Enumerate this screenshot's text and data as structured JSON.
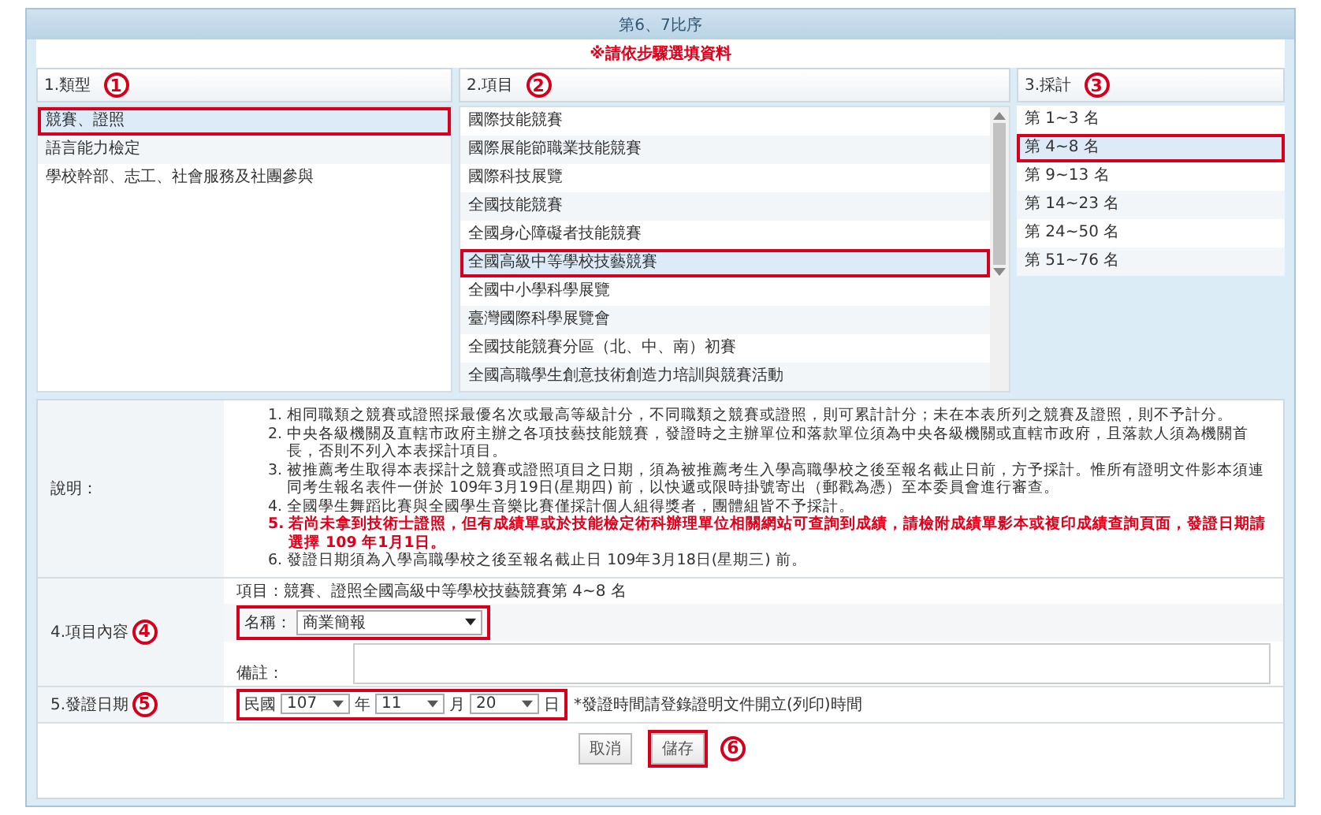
{
  "window": {
    "title": "第6、7比序"
  },
  "notice": "※請依步驟選填資料",
  "columns": [
    {
      "header": "1.類型",
      "step": "1",
      "items": [
        {
          "label": "競賽、證照",
          "selected": true,
          "highlighted": true
        },
        {
          "label": "語言能力檢定",
          "selected": false,
          "highlighted": false
        },
        {
          "label": "學校幹部、志工、社會服務及社團參與",
          "selected": false,
          "highlighted": false
        }
      ]
    },
    {
      "header": "2.項目",
      "step": "2",
      "items": [
        {
          "label": "國際技能競賽",
          "selected": false,
          "highlighted": false
        },
        {
          "label": "國際展能節職業技能競賽",
          "selected": false,
          "highlighted": false
        },
        {
          "label": "國際科技展覽",
          "selected": false,
          "highlighted": false
        },
        {
          "label": "全國技能競賽",
          "selected": false,
          "highlighted": false
        },
        {
          "label": "全國身心障礙者技能競賽",
          "selected": false,
          "highlighted": false
        },
        {
          "label": "全國高級中等學校技藝競賽",
          "selected": true,
          "highlighted": true
        },
        {
          "label": "全國中小學科學展覽",
          "selected": false,
          "highlighted": false
        },
        {
          "label": "臺灣國際科學展覽會",
          "selected": false,
          "highlighted": false
        },
        {
          "label": "全國技能競賽分區（北、中、南）初賽",
          "selected": false,
          "highlighted": false
        },
        {
          "label": "全國高職學生創意技術創造力培訓與競賽活動",
          "selected": false,
          "highlighted": false
        }
      ]
    },
    {
      "header": "3.採計",
      "step": "3",
      "items": [
        {
          "label": "第 1~3 名",
          "selected": false,
          "highlighted": false
        },
        {
          "label": "第 4~8 名",
          "selected": true,
          "highlighted": true
        },
        {
          "label": "第 9~13 名",
          "selected": false,
          "highlighted": false
        },
        {
          "label": "第 14~23 名",
          "selected": false,
          "highlighted": false
        },
        {
          "label": "第 24~50 名",
          "selected": false,
          "highlighted": false
        },
        {
          "label": "第 51~76 名",
          "selected": false,
          "highlighted": false
        }
      ]
    }
  ],
  "notes": {
    "label": "說明：",
    "items": [
      {
        "kind": "normal",
        "number": "1.",
        "text": "相同職類之競賽或證照採最優名次或最高等級計分，不同職類之競賽或證照，則可累計計分；未在本表所列之競賽及證照，則不予計分。"
      },
      {
        "kind": "normal",
        "number": "2.",
        "text": "中央各級機關及直轄市政府主辦之各項技藝技能競賽，發證時之主辦單位和落款單位須為中央各級機關或直轄市政府，且落款人須為機關首長，否則不列入本表採計項目。"
      },
      {
        "kind": "normal",
        "number": "3.",
        "text": "被推薦考生取得本表採計之競賽或證照項目之日期，須為被推薦考生入學高職學校之後至報名截止日前，方予採計。惟所有證明文件影本須連同考生報名表件一併於 109年3月19日(星期四) 前，以快遞或限時掛號寄出（郵戳為憑）至本委員會進行審查。"
      },
      {
        "kind": "normal",
        "number": "4.",
        "text": "全國學生舞蹈比賽與全國學生音樂比賽僅採計個人組得獎者，團體組皆不予採計。"
      },
      {
        "kind": "warning",
        "number": "5.",
        "text": "若尚未拿到技術士證照，但有成績單或於技能檢定術科辦理單位相關網站可查詢到成績，請檢附成績單影本或複印成績查詢頁面，發證日期請選擇 109 年1月1日。"
      },
      {
        "kind": "normal",
        "number": "6.",
        "text": "發證日期須為入學高職學校之後至報名截止日 109年3月18日(星期三) 前。"
      }
    ]
  },
  "item_content": {
    "label": "4.項目內容",
    "step": "4",
    "item_text": "項目：競賽、證照全國高級中等學校技藝競賽第 4~8 名",
    "name_label": "名稱：",
    "name_value": "商業簡報",
    "highlighted": true,
    "remark_label": "備註："
  },
  "issue_date": {
    "label": "5.發證日期",
    "step": "5",
    "era": "民國",
    "year": "107",
    "year_unit": "年",
    "month": "11",
    "month_unit": "月",
    "day": "20",
    "day_unit": "日",
    "hint": "*發證時間請登錄證明文件開立(列印)時間",
    "highlighted": true
  },
  "buttons": [
    {
      "label": "取消",
      "highlighted": false
    },
    {
      "label": "儲存",
      "highlighted": true,
      "step": "6"
    }
  ]
}
